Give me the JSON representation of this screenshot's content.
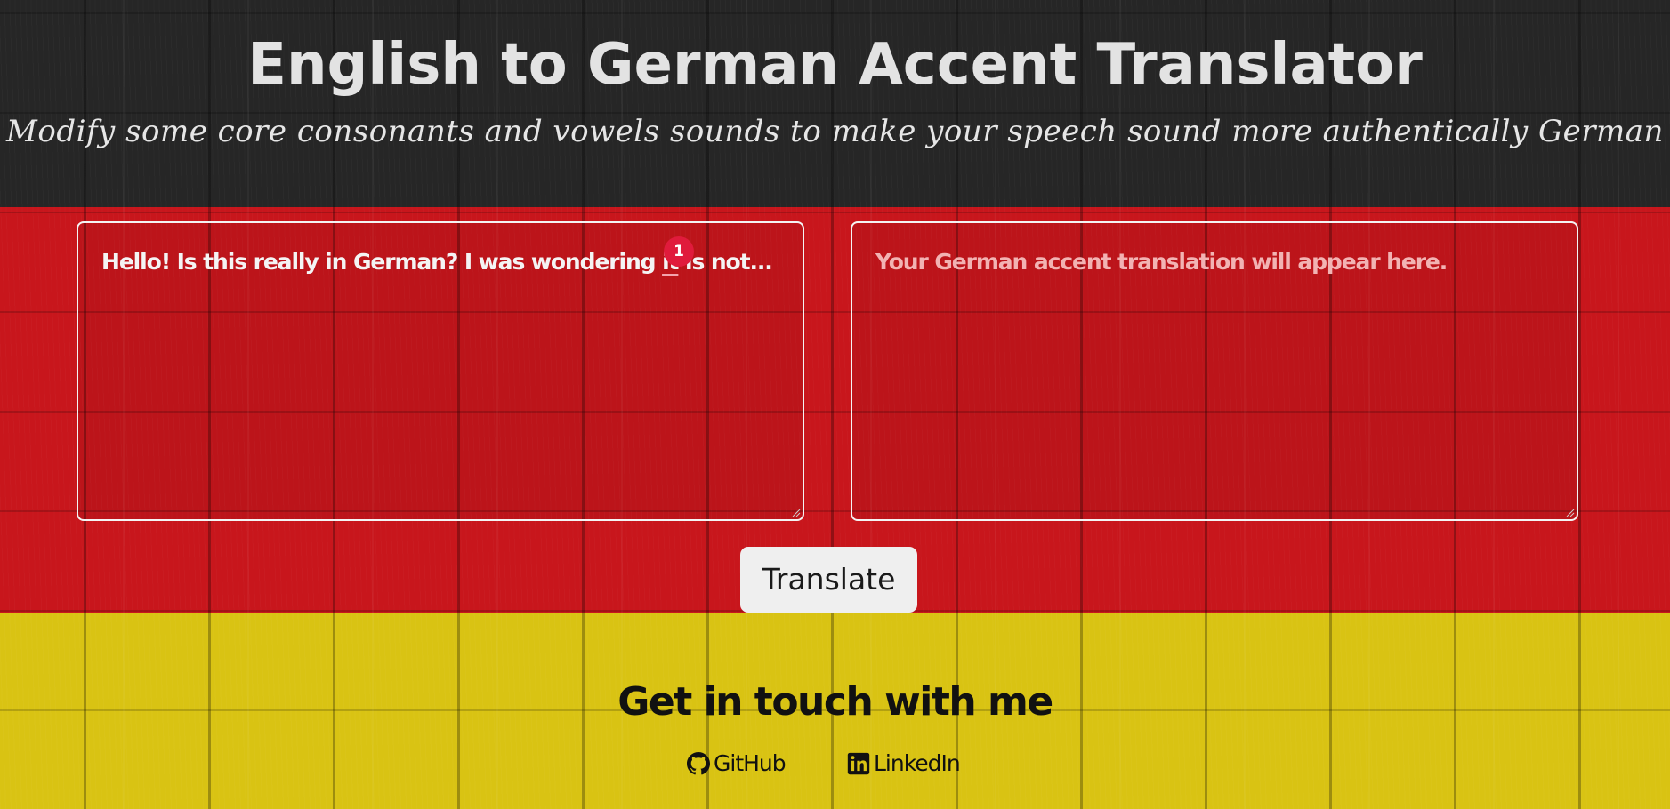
{
  "header": {
    "title": "English to German Accent Translator",
    "subtitle": "Modify some core consonants and vowels sounds to make your speech sound more authentically German"
  },
  "input_box": {
    "text_before": "Hello! Is this really in German? I was wondering ",
    "flagged_word": "it",
    "text_after": " is not...",
    "issue_count": "1"
  },
  "output_box": {
    "placeholder": "Your German accent translation will appear here."
  },
  "translate_button": {
    "label": "Translate"
  },
  "contact": {
    "heading": "Get in touch with me",
    "links": [
      {
        "label": "GitHub",
        "icon": "github-icon"
      },
      {
        "label": "LinkedIn",
        "icon": "linkedin-icon"
      }
    ]
  },
  "colors": {
    "flag_black": "#262626",
    "flag_red": "#c8161c",
    "flag_gold": "#d9c313",
    "badge_red": "#e01b3c"
  }
}
